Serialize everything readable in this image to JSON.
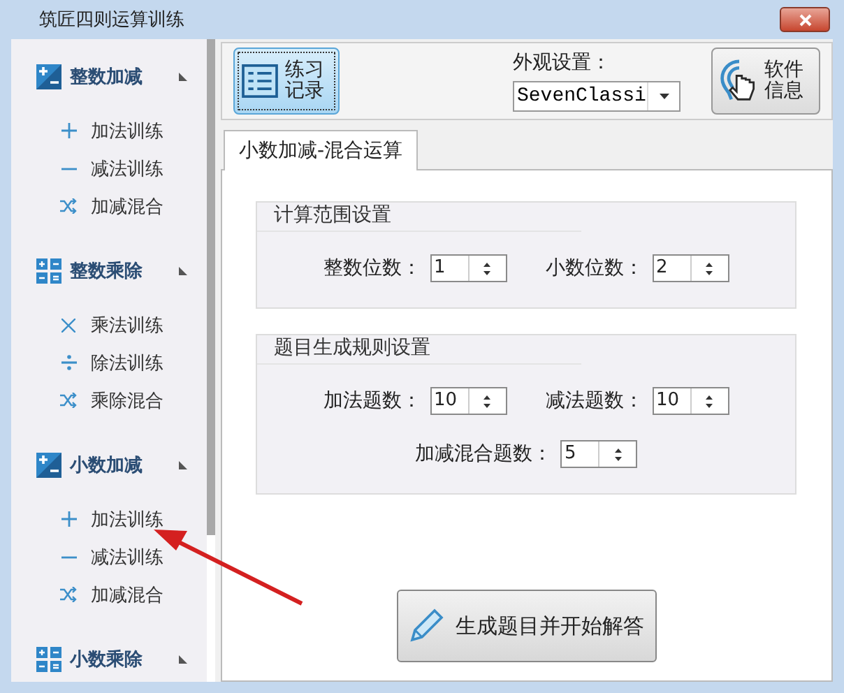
{
  "window": {
    "title": "筑匠四则运算训练"
  },
  "sidebar": {
    "groups": [
      {
        "title": "整数加减",
        "kind": "addsub",
        "items": [
          {
            "kind": "plus",
            "label": "加法训练"
          },
          {
            "kind": "minus",
            "label": "减法训练"
          },
          {
            "kind": "shuffle",
            "label": "加减混合"
          }
        ]
      },
      {
        "title": "整数乘除",
        "kind": "grid",
        "items": [
          {
            "kind": "times",
            "label": "乘法训练"
          },
          {
            "kind": "divide",
            "label": "除法训练"
          },
          {
            "kind": "shuffle",
            "label": "乘除混合"
          }
        ]
      },
      {
        "title": "小数加减",
        "kind": "addsub",
        "items": [
          {
            "kind": "plus",
            "label": "加法训练"
          },
          {
            "kind": "minus",
            "label": "减法训练"
          },
          {
            "kind": "shuffle",
            "label": "加减混合"
          }
        ]
      },
      {
        "title": "小数乘除",
        "kind": "grid"
      }
    ]
  },
  "toolbar": {
    "record_button": "练习记录",
    "appearance_label": "外观设置：",
    "appearance_value": "SevenClassi",
    "info_button": "软件信息"
  },
  "tabs": [
    {
      "label": "小数加减-混合运算",
      "selected": true
    }
  ],
  "settings": [
    {
      "title": "计算范围设置",
      "rows": [
        [
          {
            "label": "整数位数：",
            "value": "1"
          },
          {
            "label": "小数位数：",
            "value": "2"
          }
        ]
      ]
    },
    {
      "title": "题目生成规则设置",
      "rows": [
        [
          {
            "label": "加法题数：",
            "value": "10"
          },
          {
            "label": "减法题数：",
            "value": "10"
          }
        ],
        [
          {
            "label": "加减混合题数：",
            "value": "5"
          }
        ]
      ]
    }
  ],
  "action_button": "生成题目并开始解答"
}
